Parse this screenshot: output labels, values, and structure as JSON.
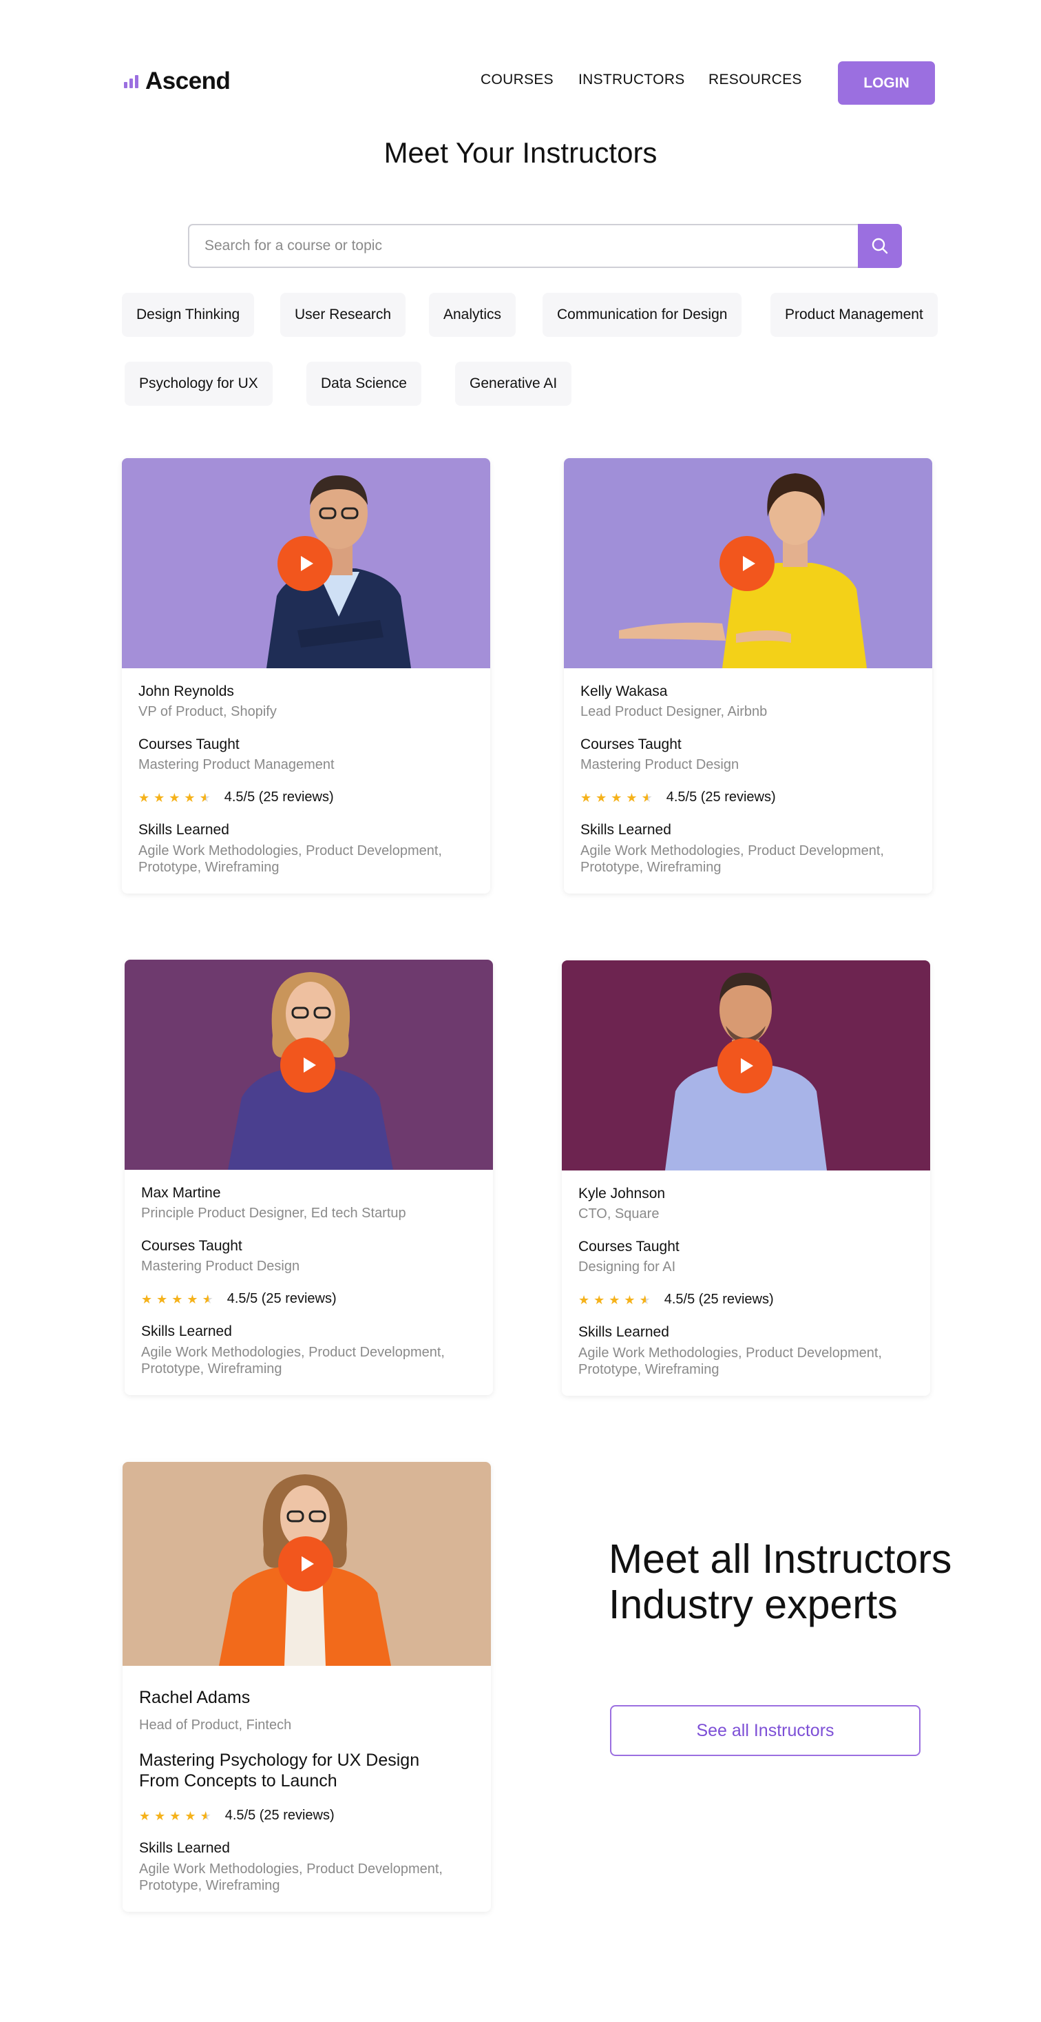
{
  "brand": {
    "name": "Ascend"
  },
  "nav": {
    "items": [
      {
        "label": "COURSES"
      },
      {
        "label": "INSTRUCTORS"
      },
      {
        "label": "RESOURCES"
      }
    ],
    "login_label": "LOGIN"
  },
  "page_title": "Meet Your Instructors",
  "search": {
    "placeholder": "Search for a course or topic",
    "icon": "search-icon"
  },
  "topics": [
    "Design Thinking",
    "User Research",
    "Analytics",
    "Communication for Design",
    "Product Management",
    "Psychology for UX",
    "Data Science",
    "Generative AI"
  ],
  "instructors": [
    {
      "name": "John Reynolds",
      "role": "VP of Product, Shopify",
      "courses_label": "Courses Taught",
      "course": "Mastering Product Management",
      "rating": 4.5,
      "rating_text": "4.5/5 (25 reviews)",
      "skills_label": "Skills Learned",
      "skills": "Agile Work Methodologies, Product Development, Prototype, Wireframing",
      "photo_bg": "#a48fd8"
    },
    {
      "name": "Kelly Wakasa",
      "role": "Lead Product Designer, Airbnb",
      "courses_label": "Courses Taught",
      "course": "Mastering Product Design",
      "rating": 4.5,
      "rating_text": "4.5/5 (25 reviews)",
      "skills_label": "Skills Learned",
      "skills": "Agile Work Methodologies, Product Development, Prototype, Wireframing",
      "photo_bg": "#a08fd8"
    },
    {
      "name": "Max Martine",
      "role": "Principle Product Designer, Ed tech Startup",
      "courses_label": "Courses Taught",
      "course": "Mastering Product Design",
      "rating": 4.5,
      "rating_text": "4.5/5 (25 reviews)",
      "skills_label": "Skills Learned",
      "skills": "Agile Work Methodologies, Product Development, Prototype, Wireframing",
      "photo_bg": "#6e3a6e"
    },
    {
      "name": "Kyle Johnson",
      "role": "CTO, Square",
      "courses_label": "Courses Taught",
      "course": "Designing for AI",
      "rating": 4.5,
      "rating_text": "4.5/5 (25 reviews)",
      "skills_label": "Skills Learned",
      "skills": "Agile Work Methodologies, Product Development, Prototype, Wireframing",
      "photo_bg": "#6d2450"
    },
    {
      "name": "Rachel Adams",
      "role": "Head of Product, Fintech",
      "course": "Mastering Psychology for UX Design From Concepts to Launch",
      "rating": 4.5,
      "rating_text": "4.5/5 (25 reviews)",
      "skills_label": "Skills Learned",
      "skills": "Agile Work Methodologies, Product Development, Prototype, Wireframing",
      "photo_bg": "#d8b596"
    }
  ],
  "cta": {
    "heading": "Meet all Instructors Industry experts",
    "button_label": "See all Instructors"
  },
  "colors": {
    "accent": "#9b6fe0",
    "play": "#f2561d",
    "star": "#f5b21b"
  }
}
